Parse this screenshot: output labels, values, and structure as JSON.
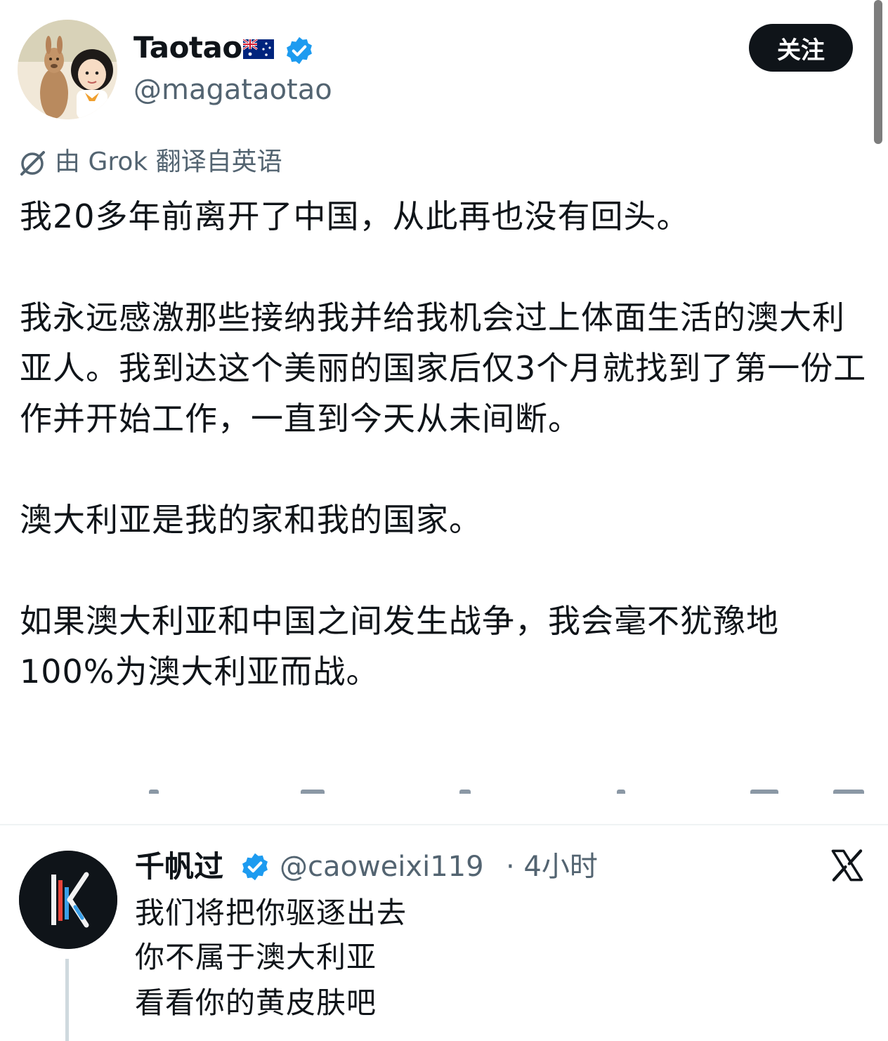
{
  "author": {
    "display_name": "Taotao",
    "flag_icon": "australia-flag-icon",
    "verified_icon": "verified-badge-icon",
    "handle": "@magataotao",
    "follow_label": "关注"
  },
  "translation_note": "由 Grok 翻译自英语",
  "tweet": {
    "paragraphs": [
      "我20多年前离开了中国，从此再也没有回头。",
      "我永远感激那些接纳我并给我机会过上体面生活的澳大利亚人。我到达这个美丽的国家后仅3个月就找到了第一份工作并开始工作，一直到今天从未间断。",
      "澳大利亚是我的家和我的国家。",
      "如果澳大利亚和中国之间发生战争，我会毫不犹豫地100%为澳大利亚而战。"
    ]
  },
  "reply": {
    "display_name": "千帆过",
    "verified_icon": "verified-badge-icon",
    "handle": "@caoweixi119",
    "time": "· 4小时",
    "platform_icon": "x-logo-icon",
    "lines": [
      "我们将把你驱逐出去",
      "你不属于澳大利亚",
      "看看你的黄皮肤吧"
    ]
  },
  "colors": {
    "text": "#0f1419",
    "secondary": "#536471",
    "verified": "#1d9bf0",
    "button_bg": "#0f1419",
    "divider": "#eff3f4"
  }
}
